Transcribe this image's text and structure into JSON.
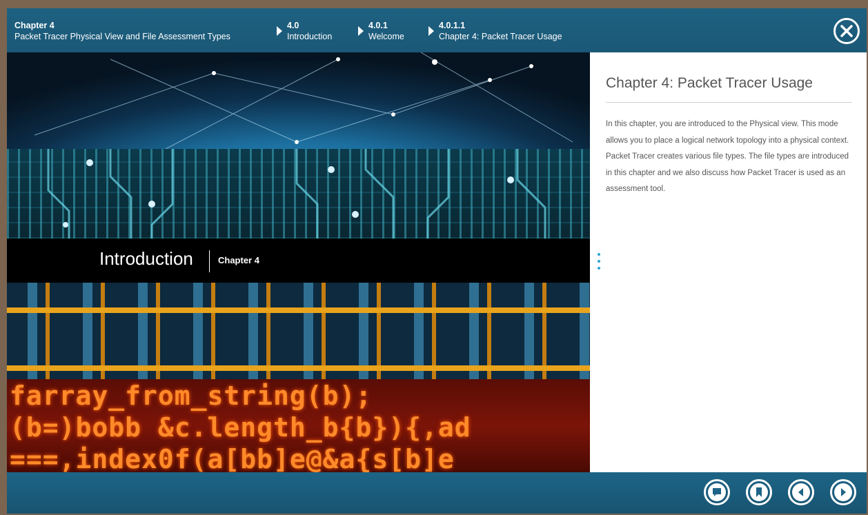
{
  "breadcrumb": [
    {
      "num": "Chapter 4",
      "label": "Packet Tracer Physical View and File Assessment Types"
    },
    {
      "num": "4.0",
      "label": "Introduction"
    },
    {
      "num": "4.0.1",
      "label": "Welcome"
    },
    {
      "num": "4.0.1.1",
      "label": "Chapter 4: Packet Tracer Usage"
    }
  ],
  "banner": {
    "title": "Introduction",
    "subtitle": "Chapter 4",
    "code_lines": [
      "farray_from_string(b);",
      "(b=)bobb &c.length_b{b}){,ad",
      "===,index0f(a[bb]e@&a{s[b]e"
    ]
  },
  "panel": {
    "title": "Chapter 4: Packet Tracer Usage",
    "body": "In this chapter, you are introduced to the Physical view. This mode allows you to place a logical network topology into a physical context. Packet Tracer creates various file types. The file types are introduced in this chapter and we also discuss how Packet Tracer is used as an assessment tool."
  },
  "icons": {
    "close": "close-icon",
    "comment": "comment-icon",
    "bookmark": "bookmark-icon",
    "previous": "previous-icon",
    "next": "next-icon"
  },
  "colors": {
    "header": "#1e6181",
    "footer": "#1d6486",
    "accent": "#2aa3d6"
  }
}
